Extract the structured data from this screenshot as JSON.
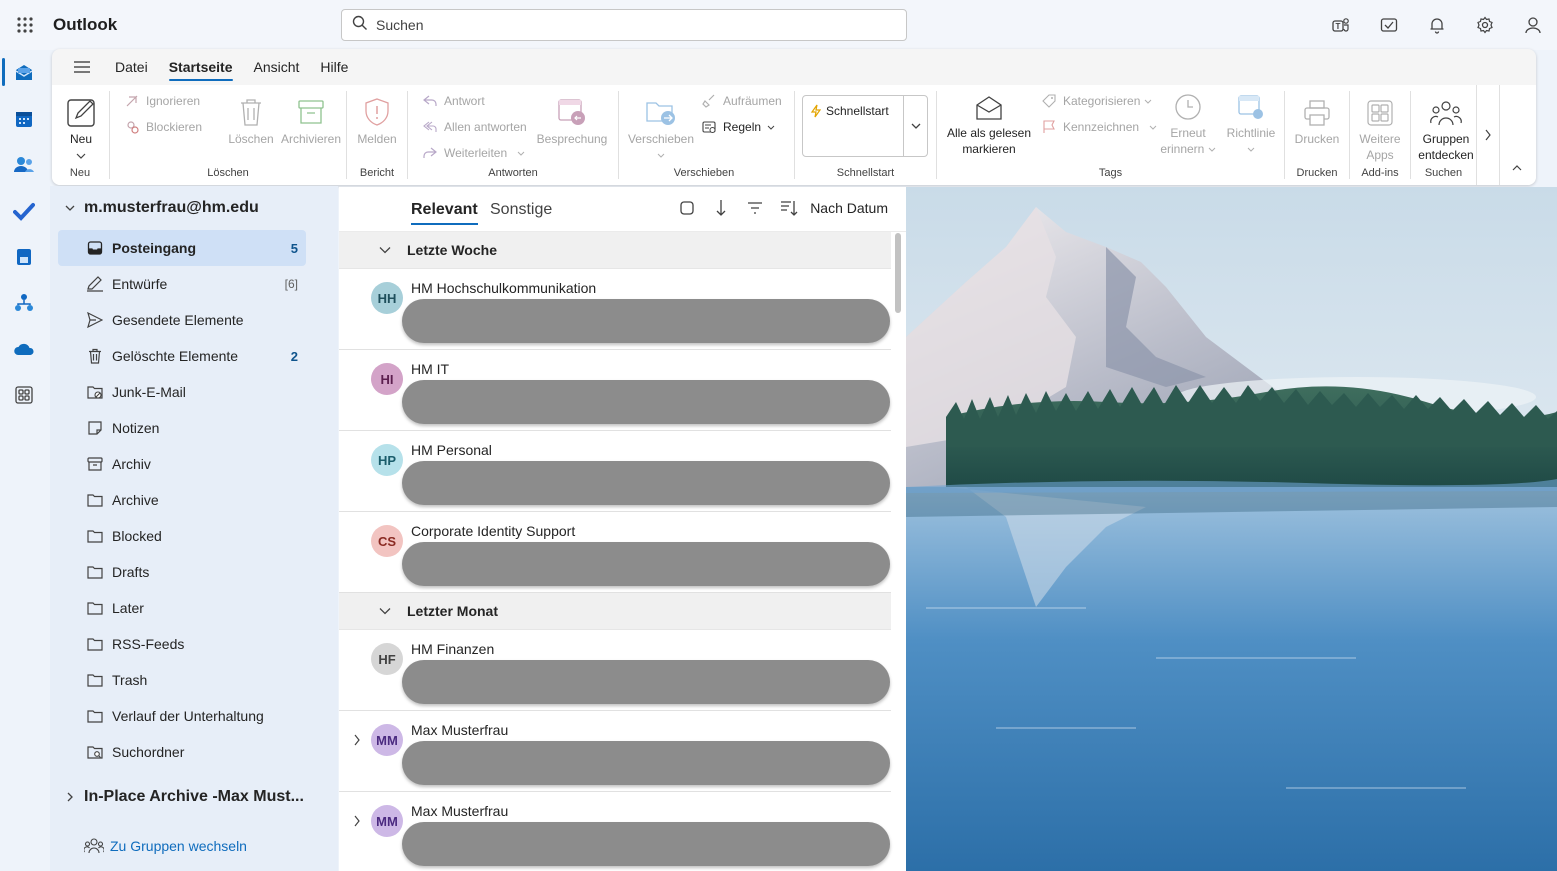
{
  "app": {
    "title": "Outlook"
  },
  "search": {
    "placeholder": "Suchen"
  },
  "top_icons": [
    "teams-icon",
    "my-day-icon",
    "bell-icon",
    "gear-icon",
    "account-icon"
  ],
  "rail": [
    "mail-icon",
    "calendar-icon",
    "people-icon",
    "todo-icon",
    "files-icon",
    "org-icon",
    "onedrive-icon",
    "apps-icon"
  ],
  "ribbon": {
    "tabs": [
      {
        "label": "Datei",
        "active": false
      },
      {
        "label": "Startseite",
        "active": true
      },
      {
        "label": "Ansicht",
        "active": false
      },
      {
        "label": "Hilfe",
        "active": false
      }
    ],
    "groups": {
      "neu": {
        "name": "Neu",
        "new_label": "Neu"
      },
      "loeschen": {
        "name": "Löschen",
        "ignore": "Ignorieren",
        "block": "Blockieren",
        "delete": "Löschen",
        "archive": "Archivieren"
      },
      "bericht": {
        "name": "Bericht",
        "report": "Melden"
      },
      "antworten": {
        "name": "Antworten",
        "reply": "Antwort",
        "reply_all": "Allen antworten",
        "forward": "Weiterleiten",
        "meeting": "Besprechung"
      },
      "verschieben": {
        "name": "Verschieben",
        "move": "Verschieben",
        "sweep": "Aufräumen",
        "rules": "Regeln"
      },
      "schnellstart": {
        "name": "Schnellstart",
        "label": "Schnellstart"
      },
      "tags": {
        "name": "Tags",
        "mark_all_line1": "Alle als gelesen",
        "mark_all_line2": "markieren",
        "categorize": "Kategorisieren",
        "flag": "Kennzeichnen",
        "remind_line1": "Erneut",
        "remind_line2": "erinnern",
        "policy": "Richtlinie"
      },
      "drucken": {
        "name": "Drucken",
        "print": "Drucken"
      },
      "addins": {
        "name": "Add-ins",
        "apps_line1": "Weitere",
        "apps_line2": "Apps"
      },
      "suchen": {
        "name": "Suchen",
        "groups_line1": "Gruppen",
        "groups_line2": "entdecken"
      }
    }
  },
  "folders": {
    "account": "m.musterfrau@hm.edu",
    "items": [
      {
        "label": "Posteingang",
        "count": "5",
        "icon": "inbox-icon",
        "active": true
      },
      {
        "label": "Entwürfe",
        "count": "[6]",
        "icon": "drafts-icon"
      },
      {
        "label": "Gesendete Elemente",
        "count": "",
        "icon": "send-icon"
      },
      {
        "label": "Gelöschte Elemente",
        "count": "2",
        "icon": "trash-icon"
      },
      {
        "label": "Junk-E-Mail",
        "count": "",
        "icon": "junk-icon"
      },
      {
        "label": "Notizen",
        "count": "",
        "icon": "note-icon"
      },
      {
        "label": "Archiv",
        "count": "",
        "icon": "archive-icon"
      },
      {
        "label": "Archive",
        "count": "",
        "icon": "folder-icon"
      },
      {
        "label": "Blocked",
        "count": "",
        "icon": "folder-icon"
      },
      {
        "label": "Drafts",
        "count": "",
        "icon": "folder-icon"
      },
      {
        "label": "Later",
        "count": "",
        "icon": "folder-icon"
      },
      {
        "label": "RSS-Feeds",
        "count": "",
        "icon": "folder-icon"
      },
      {
        "label": "Trash",
        "count": "",
        "icon": "folder-icon"
      },
      {
        "label": "Verlauf der Unterhaltung",
        "count": "",
        "icon": "folder-icon"
      },
      {
        "label": "Suchordner",
        "count": "",
        "icon": "search-folder-icon"
      }
    ],
    "archive_account": "In-Place Archive -Max Must...",
    "switch_groups": "Zu Gruppen wechseln"
  },
  "messages": {
    "tab_focused": "Relevant",
    "tab_other": "Sonstige",
    "sort_label": "Nach Datum",
    "groups": [
      {
        "label": "Letzte Woche",
        "items": [
          {
            "initials": "HH",
            "sender": "HM Hochschulkommunikation",
            "bg": "#a7cfd9",
            "fg": "#1f4f5c"
          },
          {
            "initials": "HI",
            "sender": "HM IT",
            "bg": "#d3a3c8",
            "fg": "#5c1f4f"
          },
          {
            "initials": "HP",
            "sender": "HM Personal",
            "bg": "#b6e1ea",
            "fg": "#1a5d6b"
          },
          {
            "initials": "CS",
            "sender": "Corporate Identity Support",
            "bg": "#f2c4c1",
            "fg": "#8a2a22"
          }
        ]
      },
      {
        "label": "Letzter Monat",
        "items": [
          {
            "initials": "HF",
            "sender": "HM Finanzen",
            "bg": "#d6d6d6",
            "fg": "#424242"
          },
          {
            "initials": "MM",
            "sender": "Max Musterfrau",
            "bg": "#cdb8e6",
            "fg": "#4b2a80"
          },
          {
            "initials": "MM",
            "sender": "Max Musterfrau",
            "bg": "#cdb8e6",
            "fg": "#4b2a80"
          }
        ]
      }
    ]
  },
  "colors": {
    "accent": "#0f6cbd",
    "redaction": "#8c8c8c"
  }
}
